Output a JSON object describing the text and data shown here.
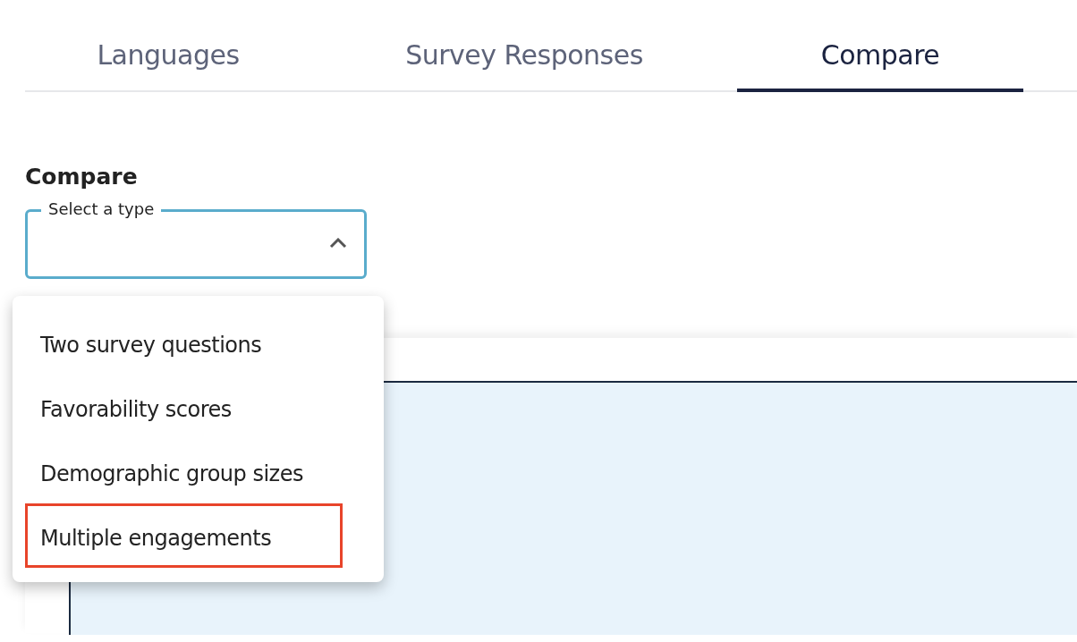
{
  "tabs": [
    {
      "label": "Languages",
      "selected": false
    },
    {
      "label": "Survey Responses",
      "selected": false
    },
    {
      "label": "Compare",
      "selected": true
    }
  ],
  "section_title": "Compare",
  "type_select": {
    "label": "Select a type",
    "expanded": true
  },
  "type_menu": [
    {
      "label": "Two survey questions",
      "highlighted": false
    },
    {
      "label": "Favorability scores",
      "highlighted": false
    },
    {
      "label": "Demographic group sizes",
      "highlighted": false
    },
    {
      "label": "Multiple engagements",
      "highlighted": true
    }
  ]
}
